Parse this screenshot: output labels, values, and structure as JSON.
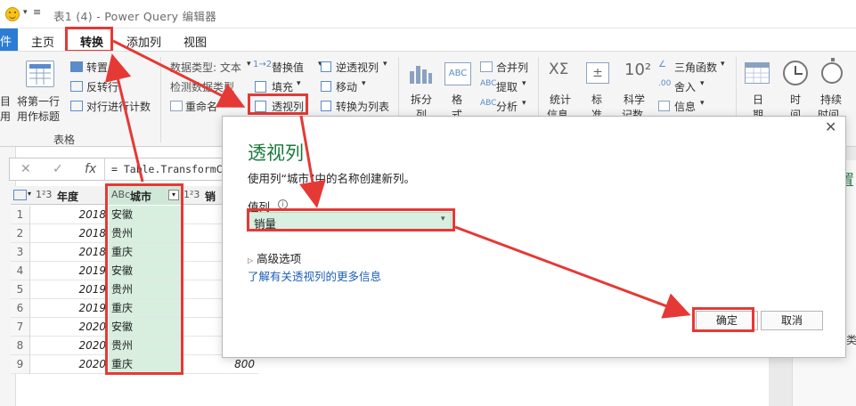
{
  "window": {
    "title": "表1 (4) - Power Query 编辑器"
  },
  "tabs": {
    "file": "件",
    "home": "主页",
    "transform": "转换",
    "add_column": "添加列",
    "view": "视图"
  },
  "ribbon": {
    "use_first_row": "将第一行",
    "as_headers": "用作标题",
    "transpose": "转置",
    "reverse_rows": "反转行",
    "count_rows": "对行进行计数",
    "group_table": "表格",
    "data_type": "数据类型: 文本",
    "detect_type": "检测数据类型",
    "rename": "重命名",
    "replace_values": "替换值",
    "fill": "填充",
    "pivot_column": "透视列",
    "unpivot_columns": "逆透视列",
    "move": "移动",
    "convert_to_list": "转换为列表",
    "split_column": "拆分",
    "split_column_2": "列",
    "format": "格",
    "format_2": "式",
    "merge_columns": "合并列",
    "extract": "提取",
    "parse": "分析",
    "statistics": "统计",
    "statistics_2": "信息",
    "standard": "标",
    "standard_2": "准",
    "scientific": "科学",
    "scientific_2": "记数",
    "trig": "三角函数",
    "rounding": "舍入",
    "information": "信息",
    "date": "日",
    "date_2": "期",
    "time": "时",
    "time_2": "间",
    "duration": "持续",
    "duration_2": "时间"
  },
  "formula": {
    "text": "= Table.TransformC"
  },
  "grid": {
    "columns": {
      "year": "年度",
      "city": "城市",
      "sales": "销"
    },
    "rows": [
      {
        "n": "1",
        "year": "2018",
        "city": "安徽",
        "sales": ""
      },
      {
        "n": "2",
        "year": "2018",
        "city": "贵州",
        "sales": ""
      },
      {
        "n": "3",
        "year": "2018",
        "city": "重庆",
        "sales": ""
      },
      {
        "n": "4",
        "year": "2019",
        "city": "安徽",
        "sales": ""
      },
      {
        "n": "5",
        "year": "2019",
        "city": "贵州",
        "sales": ""
      },
      {
        "n": "6",
        "year": "2019",
        "city": "重庆",
        "sales": ""
      },
      {
        "n": "7",
        "year": "2020",
        "city": "安徽",
        "sales": ""
      },
      {
        "n": "8",
        "year": "2020",
        "city": "贵州",
        "sales": ""
      },
      {
        "n": "9",
        "year": "2020",
        "city": "重庆",
        "sales": "800"
      }
    ]
  },
  "dialog": {
    "title": "透视列",
    "description": "使用列“城市”中的名称创建新列。",
    "value_label": "值列",
    "value_selected": "销量",
    "advanced": "高级选项",
    "learn_more": "了解有关透视列的更多信息",
    "ok": "确定",
    "cancel": "取消"
  },
  "right_panel": {
    "title_char": "置",
    "type_char": "类"
  },
  "colors": {
    "accent_green": "#1a7a3c",
    "highlight_red": "#e53935",
    "file_tab_blue": "#2b7cd3",
    "select_green": "#d9efe0"
  }
}
